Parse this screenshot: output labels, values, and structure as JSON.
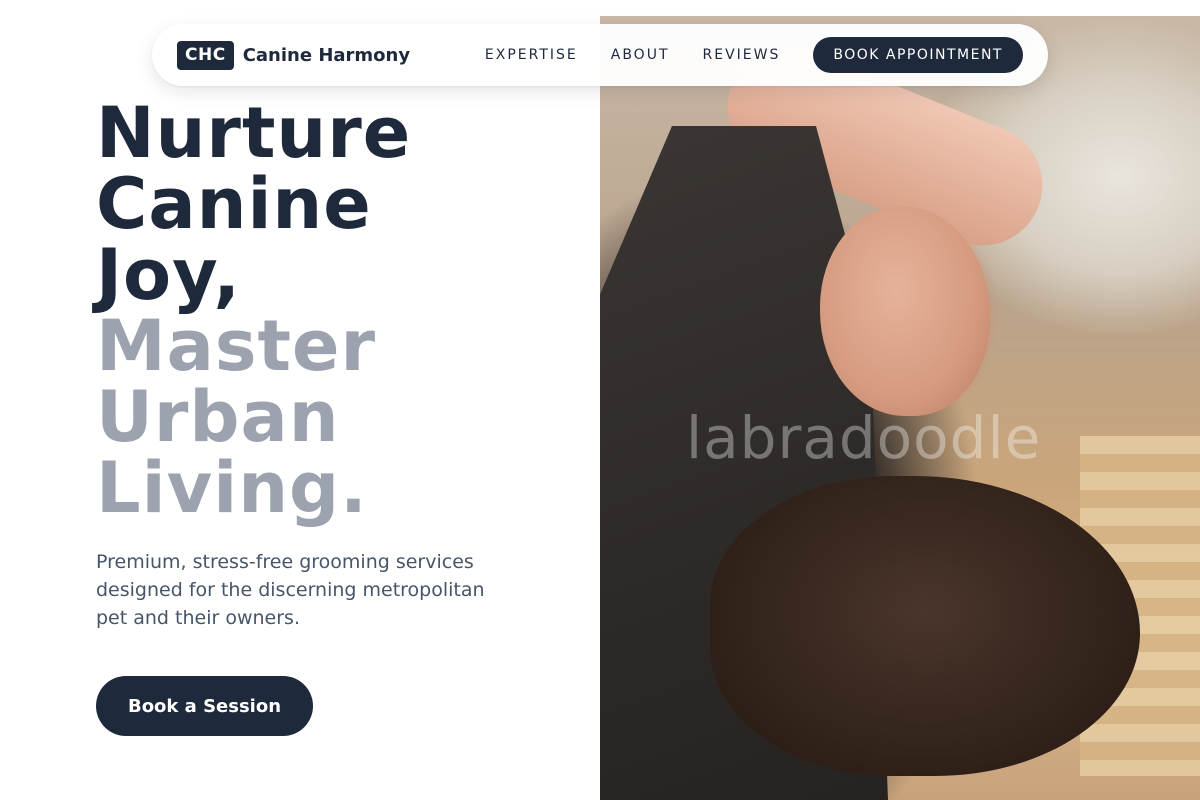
{
  "nav": {
    "logo_badge": "CHC",
    "brand_name": "Canine Harmony",
    "links": [
      "EXPERTISE",
      "ABOUT",
      "REVIEWS"
    ],
    "cta": "BOOK APPOINTMENT"
  },
  "hero": {
    "headline_dark": [
      "Nurture",
      "Canine",
      "Joy,"
    ],
    "headline_muted": [
      "Master",
      "Urban",
      "Living."
    ],
    "subcopy": "Premium, stress-free grooming services designed for the discerning metropolitan pet and their owners.",
    "cta": "Book a Session",
    "photo_watermark": "labradoodle"
  },
  "colors": {
    "brand_dark": "#1e293b",
    "headline_muted": "#9ca3af",
    "body_text": "#475569",
    "background": "#ffffff"
  },
  "icons": []
}
